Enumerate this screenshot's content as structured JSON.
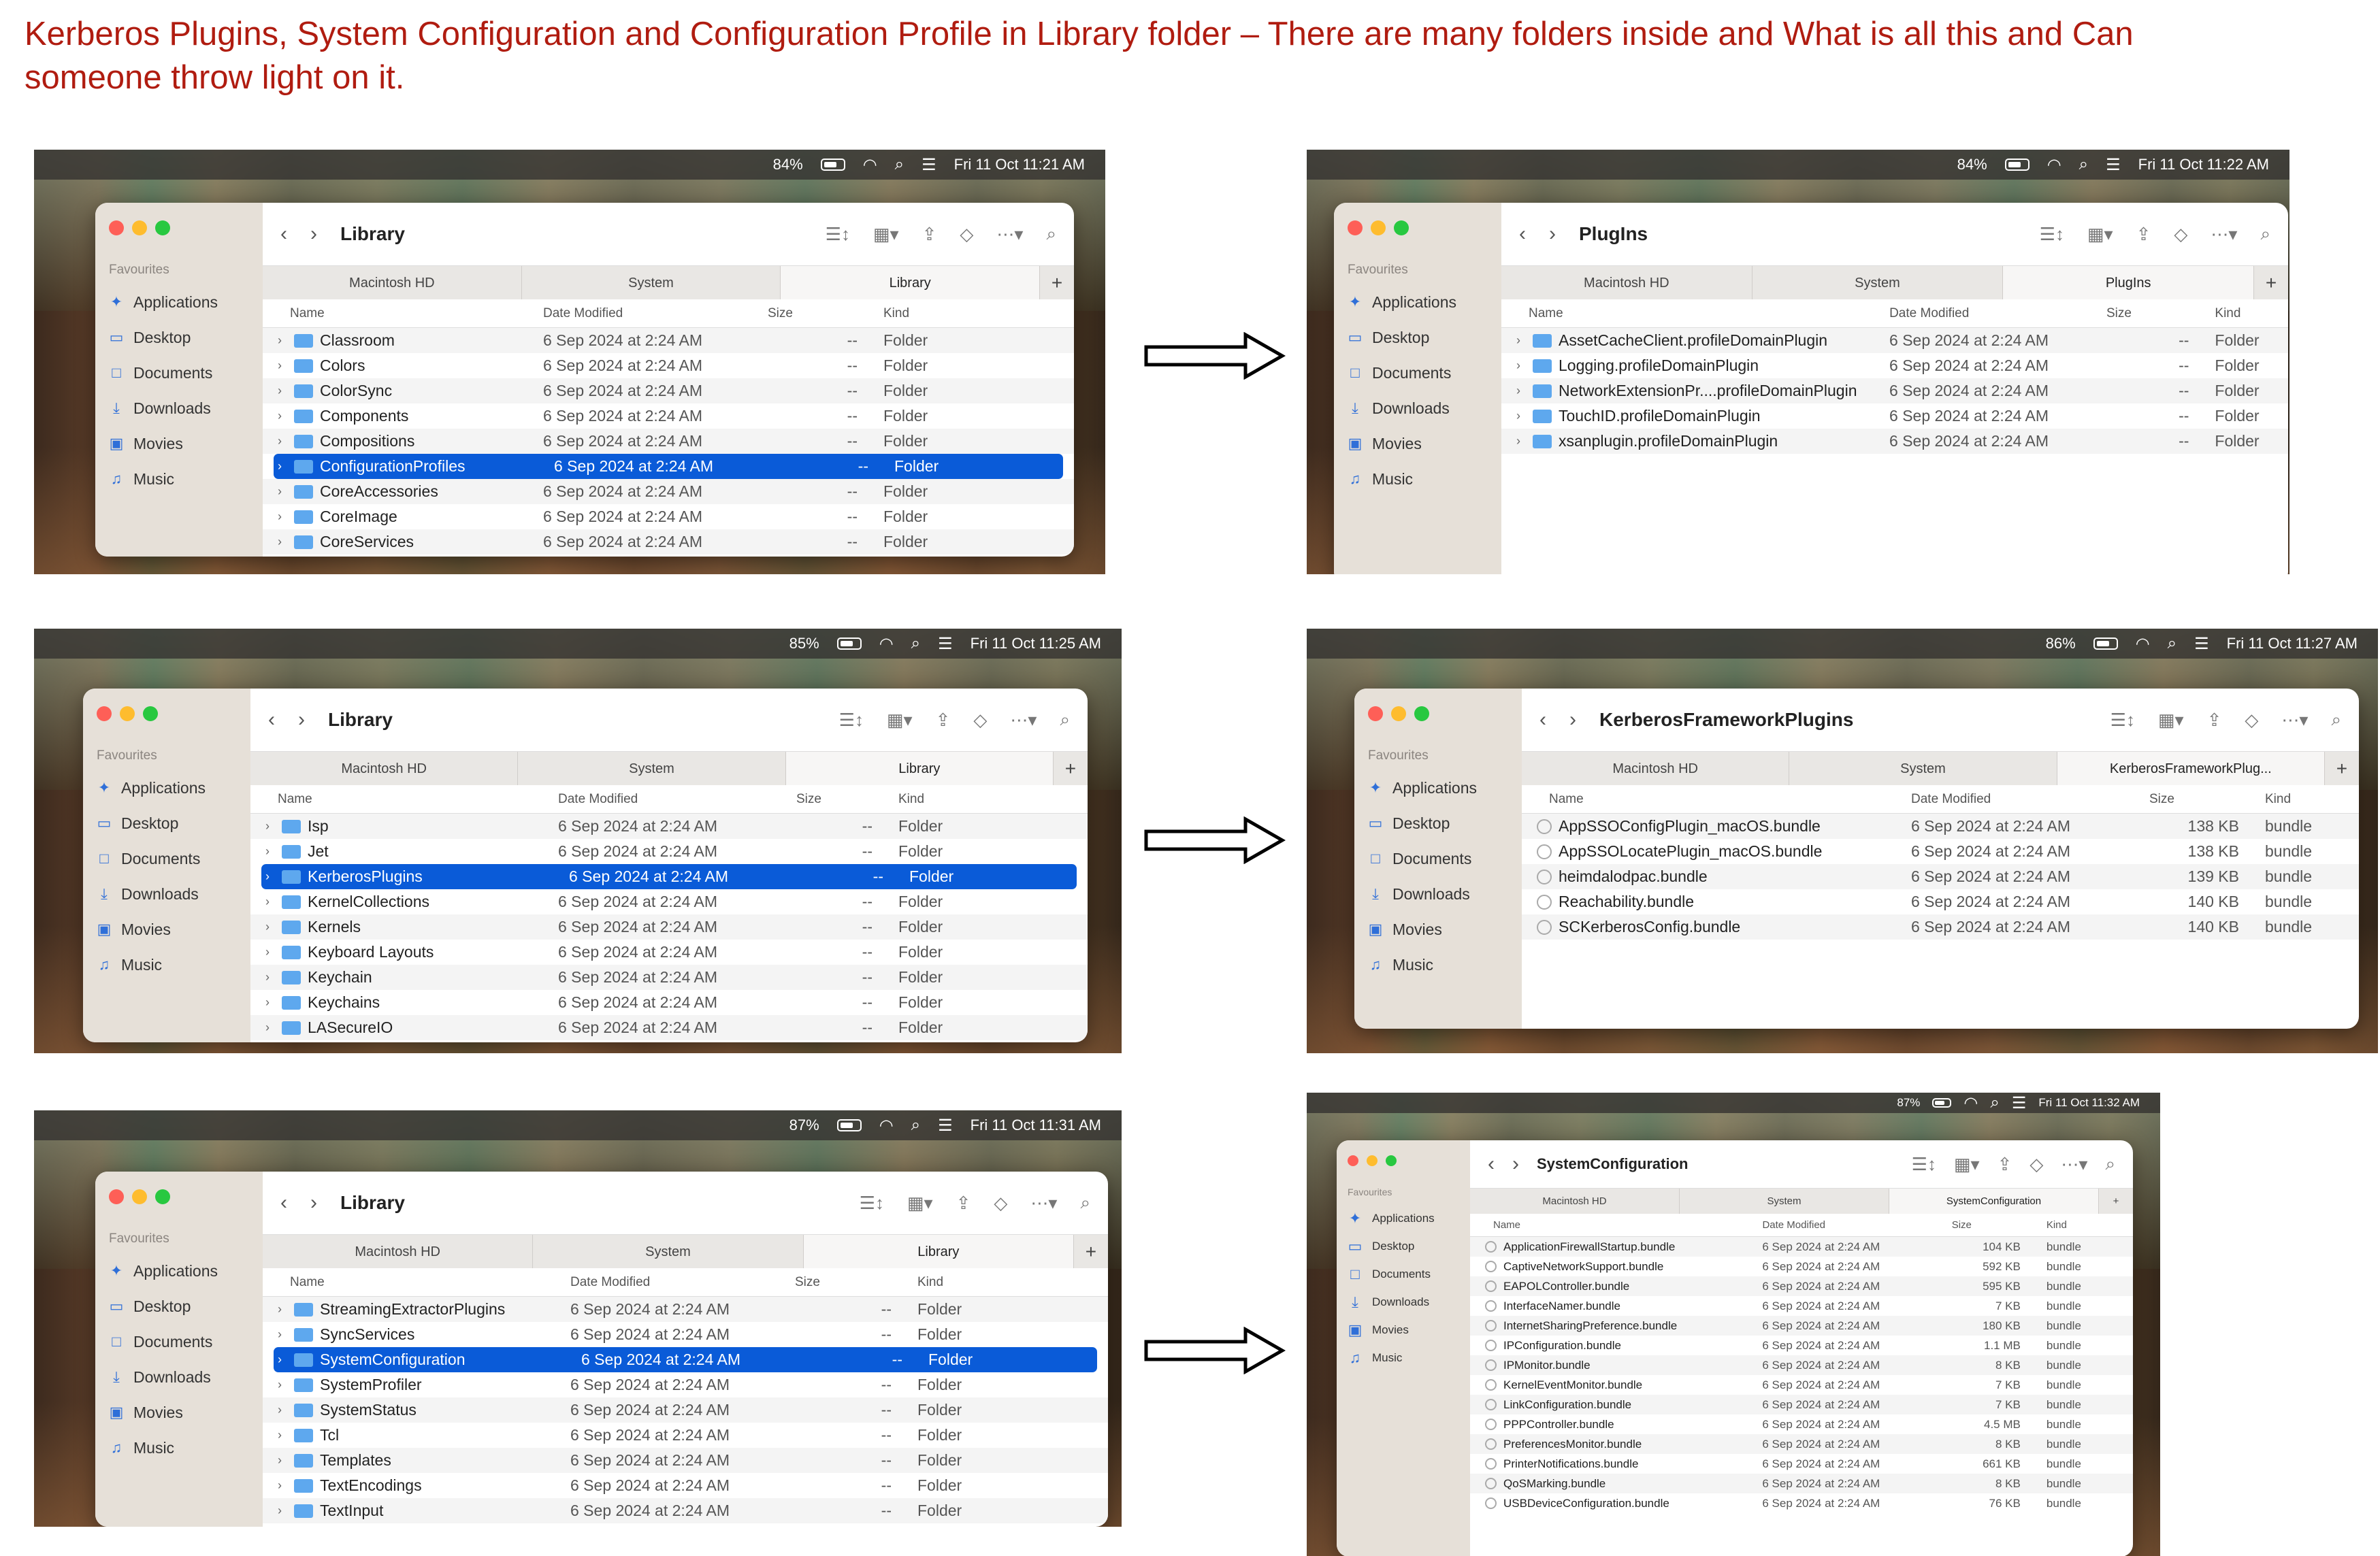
{
  "heading": "Kerberos Plugins, System Configuration and Configuration Profile in Library folder – There are many folders inside and What is all this and Can someone throw light on it.",
  "sidebar": {
    "favourites": "Favourites",
    "items": [
      {
        "label": "Applications",
        "icon": "applications-icon",
        "glyph": "✦"
      },
      {
        "label": "Desktop",
        "icon": "desktop-icon",
        "glyph": "▭"
      },
      {
        "label": "Documents",
        "icon": "document-icon",
        "glyph": "□"
      },
      {
        "label": "Downloads",
        "icon": "download-icon",
        "glyph": "⤓"
      },
      {
        "label": "Movies",
        "icon": "film-icon",
        "glyph": "▣"
      },
      {
        "label": "Music",
        "icon": "music-note-icon",
        "glyph": "♫"
      }
    ]
  },
  "columns": {
    "name": "Name",
    "date": "Date Modified",
    "size": "Size",
    "kind": "Kind"
  },
  "shots": [
    {
      "menubar": {
        "battery": "84%",
        "time": "Fri 11 Oct  11:21 AM"
      },
      "title": "Library",
      "tabs": [
        "Macintosh HD",
        "System",
        "Library"
      ],
      "rows": [
        {
          "name": "Classroom",
          "date": "6 Sep 2024 at 2:24 AM",
          "size": "--",
          "kind": "Folder"
        },
        {
          "name": "Colors",
          "date": "6 Sep 2024 at 2:24 AM",
          "size": "--",
          "kind": "Folder"
        },
        {
          "name": "ColorSync",
          "date": "6 Sep 2024 at 2:24 AM",
          "size": "--",
          "kind": "Folder"
        },
        {
          "name": "Components",
          "date": "6 Sep 2024 at 2:24 AM",
          "size": "--",
          "kind": "Folder"
        },
        {
          "name": "Compositions",
          "date": "6 Sep 2024 at 2:24 AM",
          "size": "--",
          "kind": "Folder"
        },
        {
          "name": "ConfigurationProfiles",
          "date": "6 Sep 2024 at 2:24 AM",
          "size": "--",
          "kind": "Folder",
          "selected": true
        },
        {
          "name": "CoreAccessories",
          "date": "6 Sep 2024 at 2:24 AM",
          "size": "--",
          "kind": "Folder"
        },
        {
          "name": "CoreImage",
          "date": "6 Sep 2024 at 2:24 AM",
          "size": "--",
          "kind": "Folder"
        },
        {
          "name": "CoreServices",
          "date": "6 Sep 2024 at 2:24 AM",
          "size": "--",
          "kind": "Folder"
        }
      ]
    },
    {
      "menubar": {
        "battery": "84%",
        "time": "Fri 11 Oct  11:22 AM"
      },
      "title": "PlugIns",
      "tabs": [
        "Macintosh HD",
        "System",
        "PlugIns"
      ],
      "rows": [
        {
          "name": "AssetCacheClient.profileDomainPlugin",
          "date": "6 Sep 2024 at 2:24 AM",
          "size": "--",
          "kind": "Folder"
        },
        {
          "name": "Logging.profileDomainPlugin",
          "date": "6 Sep 2024 at 2:24 AM",
          "size": "--",
          "kind": "Folder"
        },
        {
          "name": "NetworkExtensionPr....profileDomainPlugin",
          "date": "6 Sep 2024 at 2:24 AM",
          "size": "--",
          "kind": "Folder"
        },
        {
          "name": "TouchID.profileDomainPlugin",
          "date": "6 Sep 2024 at 2:24 AM",
          "size": "--",
          "kind": "Folder"
        },
        {
          "name": "xsanplugin.profileDomainPlugin",
          "date": "6 Sep 2024 at 2:24 AM",
          "size": "--",
          "kind": "Folder"
        }
      ]
    },
    {
      "menubar": {
        "battery": "85%",
        "time": "Fri 11 Oct  11:25 AM"
      },
      "title": "Library",
      "tabs": [
        "Macintosh HD",
        "System",
        "Library"
      ],
      "rows": [
        {
          "name": "Isp",
          "date": "6 Sep 2024 at 2:24 AM",
          "size": "--",
          "kind": "Folder"
        },
        {
          "name": "Jet",
          "date": "6 Sep 2024 at 2:24 AM",
          "size": "--",
          "kind": "Folder"
        },
        {
          "name": "KerberosPlugins",
          "date": "6 Sep 2024 at 2:24 AM",
          "size": "--",
          "kind": "Folder",
          "selected": true
        },
        {
          "name": "KernelCollections",
          "date": "6 Sep 2024 at 2:24 AM",
          "size": "--",
          "kind": "Folder"
        },
        {
          "name": "Kernels",
          "date": "6 Sep 2024 at 2:24 AM",
          "size": "--",
          "kind": "Folder"
        },
        {
          "name": "Keyboard Layouts",
          "date": "6 Sep 2024 at 2:24 AM",
          "size": "--",
          "kind": "Folder"
        },
        {
          "name": "Keychain",
          "date": "6 Sep 2024 at 2:24 AM",
          "size": "--",
          "kind": "Folder"
        },
        {
          "name": "Keychains",
          "date": "6 Sep 2024 at 2:24 AM",
          "size": "--",
          "kind": "Folder"
        },
        {
          "name": "LASecureIO",
          "date": "6 Sep 2024 at 2:24 AM",
          "size": "--",
          "kind": "Folder"
        }
      ]
    },
    {
      "menubar": {
        "battery": "86%",
        "time": "Fri 11 Oct  11:27 AM"
      },
      "title": "KerberosFrameworkPlugins",
      "tabs": [
        "Macintosh HD",
        "System",
        "KerberosFrameworkPlug..."
      ],
      "rows": [
        {
          "name": "AppSSOConfigPlugin_macOS.bundle",
          "date": "6 Sep 2024 at 2:24 AM",
          "size": "138 KB",
          "kind": "bundle",
          "bundle": true
        },
        {
          "name": "AppSSOLocatePlugin_macOS.bundle",
          "date": "6 Sep 2024 at 2:24 AM",
          "size": "138 KB",
          "kind": "bundle",
          "bundle": true
        },
        {
          "name": "heimdalodpac.bundle",
          "date": "6 Sep 2024 at 2:24 AM",
          "size": "139 KB",
          "kind": "bundle",
          "bundle": true
        },
        {
          "name": "Reachability.bundle",
          "date": "6 Sep 2024 at 2:24 AM",
          "size": "140 KB",
          "kind": "bundle",
          "bundle": true
        },
        {
          "name": "SCKerberosConfig.bundle",
          "date": "6 Sep 2024 at 2:24 AM",
          "size": "140 KB",
          "kind": "bundle",
          "bundle": true
        }
      ]
    },
    {
      "menubar": {
        "battery": "87%",
        "time": "Fri 11 Oct  11:31 AM"
      },
      "title": "Library",
      "tabs": [
        "Macintosh HD",
        "System",
        "Library"
      ],
      "rows": [
        {
          "name": "StreamingExtractorPlugins",
          "date": "6 Sep 2024 at 2:24 AM",
          "size": "--",
          "kind": "Folder"
        },
        {
          "name": "SyncServices",
          "date": "6 Sep 2024 at 2:24 AM",
          "size": "--",
          "kind": "Folder"
        },
        {
          "name": "SystemConfiguration",
          "date": "6 Sep 2024 at 2:24 AM",
          "size": "--",
          "kind": "Folder",
          "selected": true
        },
        {
          "name": "SystemProfiler",
          "date": "6 Sep 2024 at 2:24 AM",
          "size": "--",
          "kind": "Folder"
        },
        {
          "name": "SystemStatus",
          "date": "6 Sep 2024 at 2:24 AM",
          "size": "--",
          "kind": "Folder"
        },
        {
          "name": "Tcl",
          "date": "6 Sep 2024 at 2:24 AM",
          "size": "--",
          "kind": "Folder"
        },
        {
          "name": "Templates",
          "date": "6 Sep 2024 at 2:24 AM",
          "size": "--",
          "kind": "Folder"
        },
        {
          "name": "TextEncodings",
          "date": "6 Sep 2024 at 2:24 AM",
          "size": "--",
          "kind": "Folder"
        },
        {
          "name": "TextInput",
          "date": "6 Sep 2024 at 2:24 AM",
          "size": "--",
          "kind": "Folder"
        }
      ]
    },
    {
      "menubar": {
        "battery": "87%",
        "time": "Fri 11 Oct  11:32 AM"
      },
      "title": "SystemConfiguration",
      "tabs": [
        "Macintosh HD",
        "System",
        "SystemConfiguration"
      ],
      "rows": [
        {
          "name": "ApplicationFirewallStartup.bundle",
          "date": "6 Sep 2024 at 2:24 AM",
          "size": "104 KB",
          "kind": "bundle",
          "bundle": true
        },
        {
          "name": "CaptiveNetworkSupport.bundle",
          "date": "6 Sep 2024 at 2:24 AM",
          "size": "592 KB",
          "kind": "bundle",
          "bundle": true
        },
        {
          "name": "EAPOLController.bundle",
          "date": "6 Sep 2024 at 2:24 AM",
          "size": "595 KB",
          "kind": "bundle",
          "bundle": true
        },
        {
          "name": "InterfaceNamer.bundle",
          "date": "6 Sep 2024 at 2:24 AM",
          "size": "7 KB",
          "kind": "bundle",
          "bundle": true
        },
        {
          "name": "InternetSharingPreference.bundle",
          "date": "6 Sep 2024 at 2:24 AM",
          "size": "180 KB",
          "kind": "bundle",
          "bundle": true
        },
        {
          "name": "IPConfiguration.bundle",
          "date": "6 Sep 2024 at 2:24 AM",
          "size": "1.1 MB",
          "kind": "bundle",
          "bundle": true
        },
        {
          "name": "IPMonitor.bundle",
          "date": "6 Sep 2024 at 2:24 AM",
          "size": "8 KB",
          "kind": "bundle",
          "bundle": true
        },
        {
          "name": "KernelEventMonitor.bundle",
          "date": "6 Sep 2024 at 2:24 AM",
          "size": "7 KB",
          "kind": "bundle",
          "bundle": true
        },
        {
          "name": "LinkConfiguration.bundle",
          "date": "6 Sep 2024 at 2:24 AM",
          "size": "7 KB",
          "kind": "bundle",
          "bundle": true
        },
        {
          "name": "PPPController.bundle",
          "date": "6 Sep 2024 at 2:24 AM",
          "size": "4.5 MB",
          "kind": "bundle",
          "bundle": true
        },
        {
          "name": "PreferencesMonitor.bundle",
          "date": "6 Sep 2024 at 2:24 AM",
          "size": "8 KB",
          "kind": "bundle",
          "bundle": true
        },
        {
          "name": "PrinterNotifications.bundle",
          "date": "6 Sep 2024 at 2:24 AM",
          "size": "661 KB",
          "kind": "bundle",
          "bundle": true
        },
        {
          "name": "QoSMarking.bundle",
          "date": "6 Sep 2024 at 2:24 AM",
          "size": "8 KB",
          "kind": "bundle",
          "bundle": true
        },
        {
          "name": "USBDeviceConfiguration.bundle",
          "date": "6 Sep 2024 at 2:24 AM",
          "size": "76 KB",
          "kind": "bundle",
          "bundle": true
        }
      ]
    }
  ]
}
